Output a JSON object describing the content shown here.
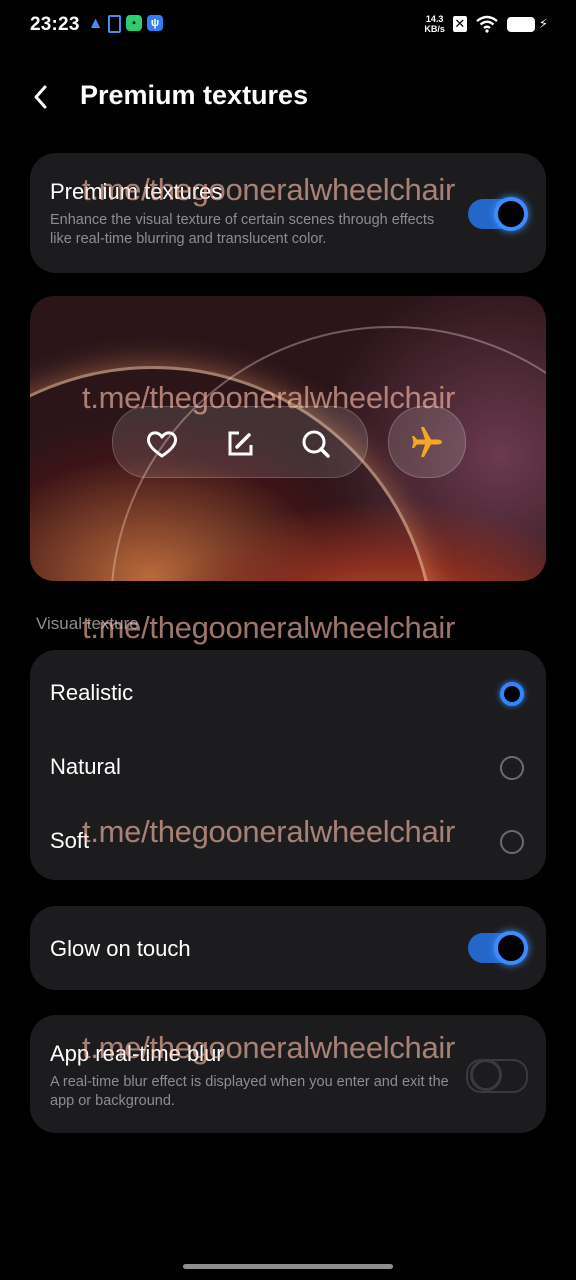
{
  "status_bar": {
    "time": "23:23",
    "net_speed_value": "14.3",
    "net_speed_unit": "KB/s"
  },
  "header": {
    "title": "Premium textures"
  },
  "premium": {
    "title": "Premium textures",
    "description": "Enhance the visual texture of certain scenes through effects like real-time blurring and translucent color.",
    "enabled": true
  },
  "preview": {
    "dock_icons": [
      "heart-icon",
      "edit-icon",
      "search-icon"
    ],
    "fab_icon": "airplane-icon"
  },
  "visual_texture": {
    "section_label": "Visual texture",
    "options": [
      "Realistic",
      "Natural",
      "Soft"
    ],
    "selected": "Realistic"
  },
  "glow": {
    "title": "Glow on touch",
    "enabled": true
  },
  "app_blur": {
    "title": "App real-time blur",
    "description": "A real-time blur effect is displayed when you enter and exit the app or background.",
    "enabled": false
  },
  "watermark": {
    "text": "t.me/thegooneralwheelchair"
  },
  "colors": {
    "accent": "#2f86ff",
    "card": "#1c1c1e",
    "background": "#000000",
    "secondary_text": "#8d8d92",
    "watermark": "#ffbeaa"
  }
}
